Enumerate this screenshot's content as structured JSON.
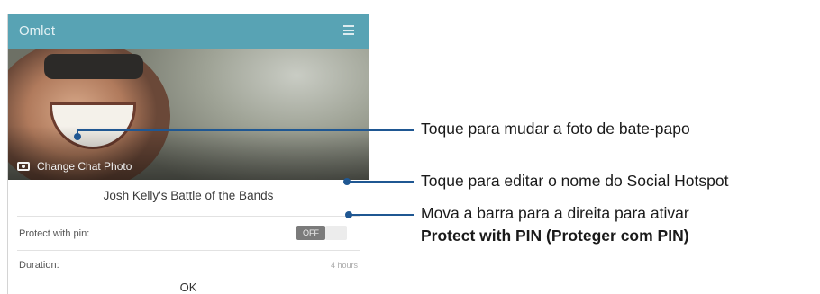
{
  "app": {
    "title": "Omlet",
    "menu_icon": "list-menu-icon"
  },
  "photo": {
    "change_label": "Change Chat Photo",
    "camera_icon": "camera-icon"
  },
  "chat": {
    "name": "Josh Kelly's Battle of the Bands"
  },
  "settings": {
    "pin_label": "Protect with pin:",
    "pin_toggle": "OFF",
    "duration_label": "Duration:",
    "duration_value": "4 hours"
  },
  "ok_label": "OK",
  "callouts": {
    "photo": "Toque para mudar a foto de bate-papo",
    "name": "Toque para editar o nome do Social Hotspot",
    "pin_line1": "Mova a barra para a direita para ativar",
    "pin_line2": "Protect with PIN (Proteger com PIN)"
  },
  "colors": {
    "appbar": "#58a3b4",
    "callout": "#1f5792"
  }
}
